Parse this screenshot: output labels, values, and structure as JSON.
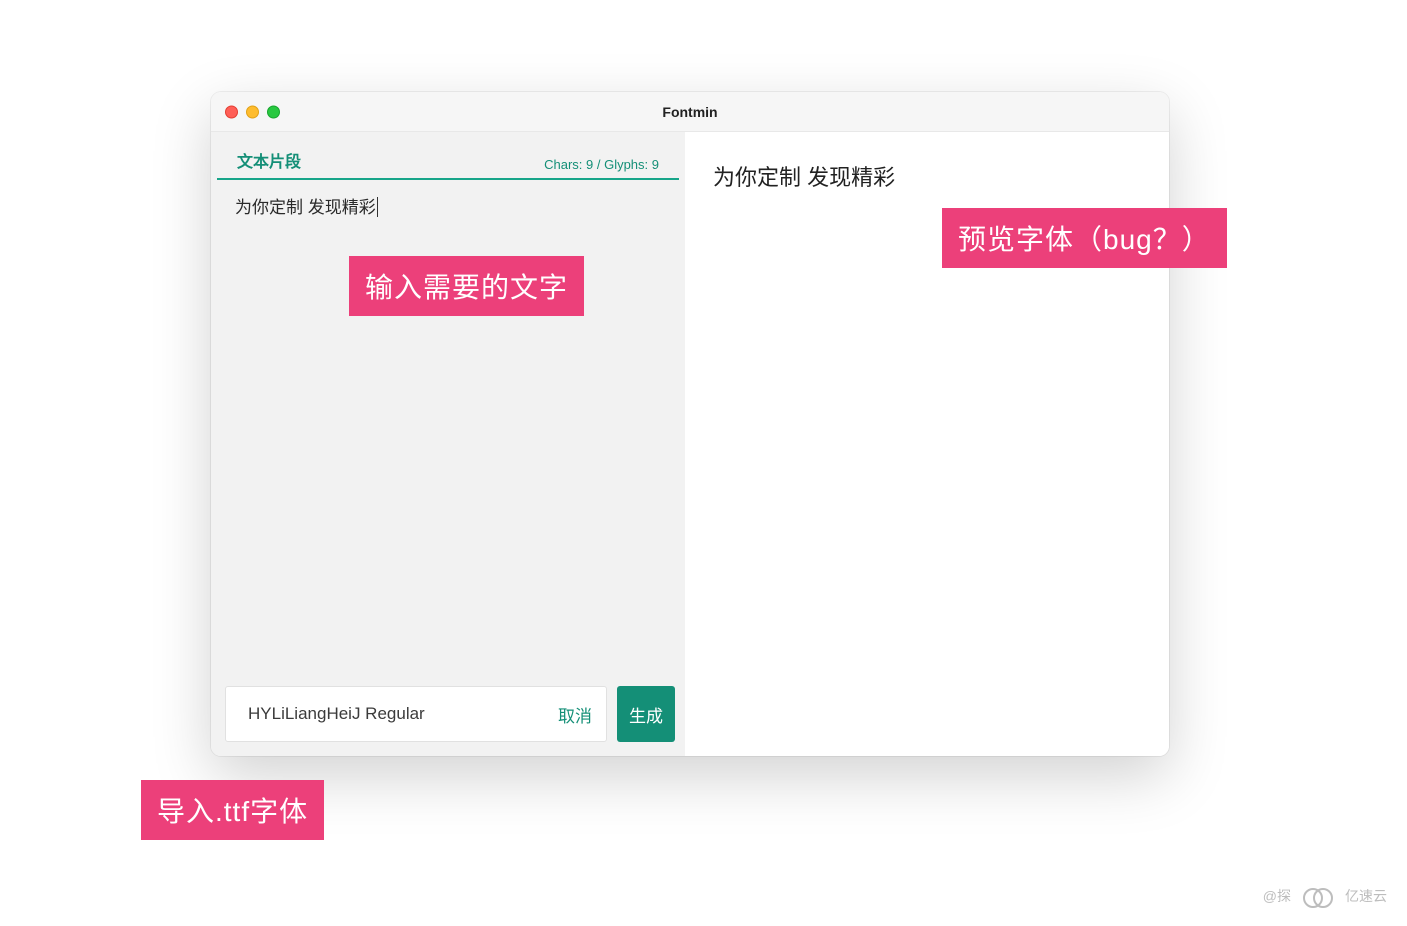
{
  "window": {
    "title": "Fontmin"
  },
  "left": {
    "section_title": "文本片段",
    "stats": "Chars: 9 / Glyphs: 9",
    "input_text": "为你定制 发现精彩"
  },
  "bottom": {
    "font_name": "HYLiLiangHeiJ Regular",
    "cancel_label": "取消",
    "generate_label": "生成"
  },
  "preview": {
    "text": "为你定制 发现精彩"
  },
  "annotations": {
    "input_hint": "输入需要的文字",
    "preview_hint": "预览字体（bug？）",
    "import_hint": "导入.ttf字体"
  },
  "watermark": {
    "handle": "@探",
    "brand": "亿速云"
  },
  "colors": {
    "accent": "#148f77",
    "annotation_bg": "#ec407a",
    "window_bg": "#ffffff",
    "left_pane_bg": "#f2f2f2"
  }
}
